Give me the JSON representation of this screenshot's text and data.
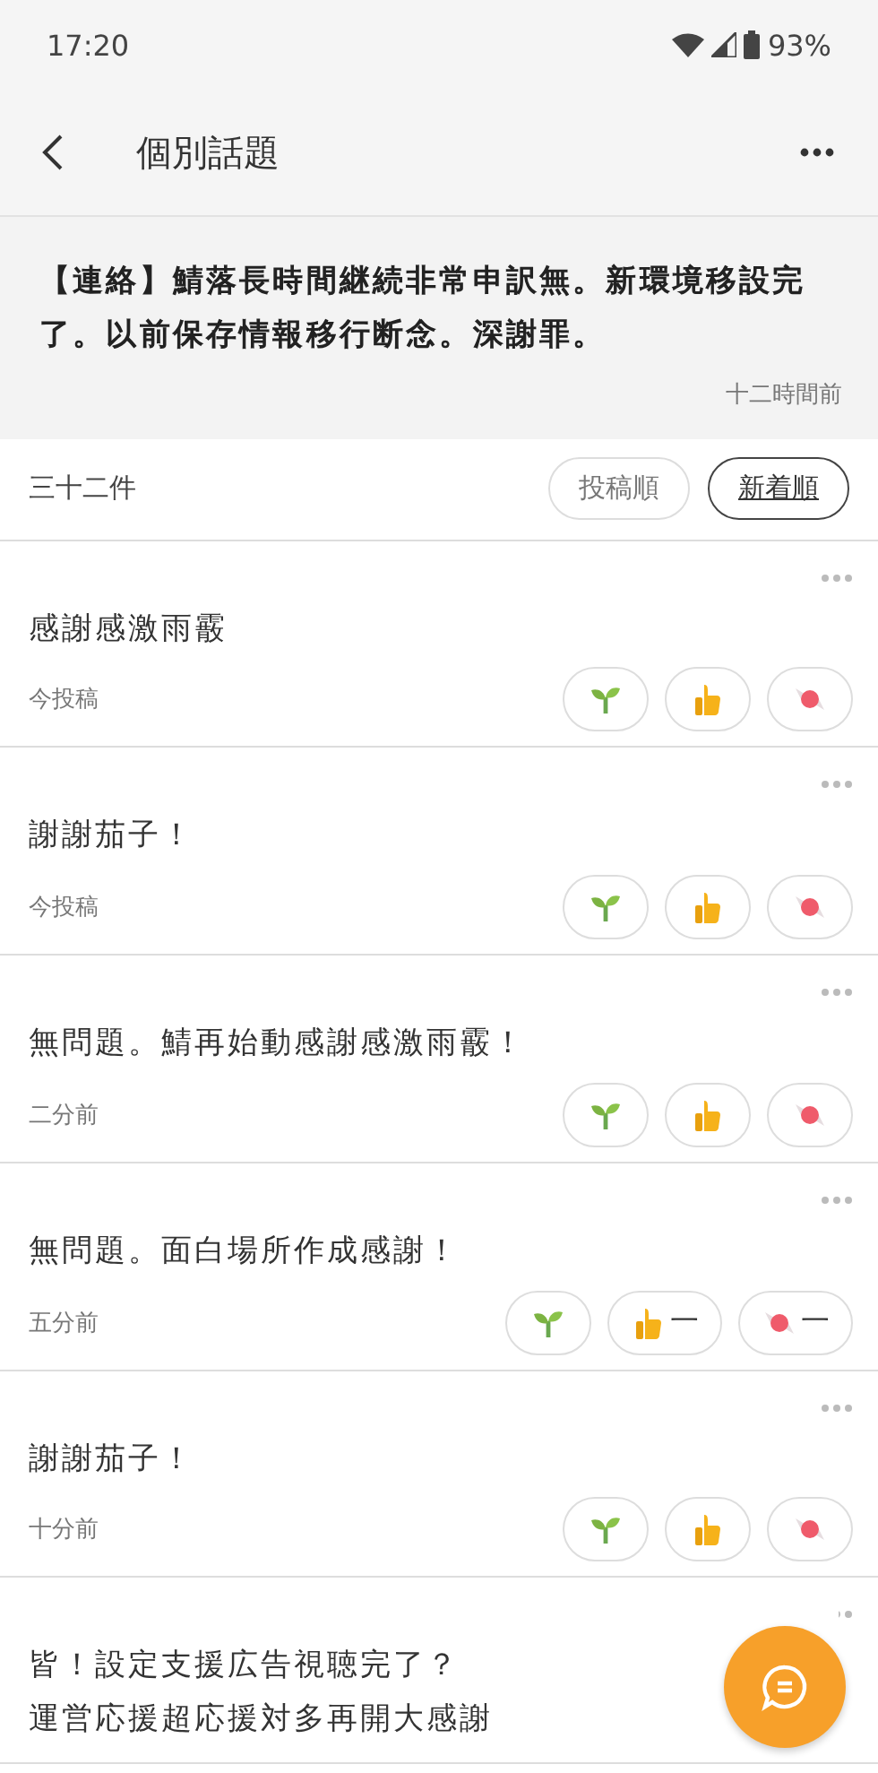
{
  "status_bar": {
    "time": "17:20",
    "battery": "93%"
  },
  "header": {
    "title": "個別話題"
  },
  "announcement": {
    "text": "【連絡】鯖落長時間継続非常申訳無。新環境移設完了。以前保存情報移行断念。深謝罪。",
    "time": "十二時間前"
  },
  "list_header": {
    "count": "三十二件",
    "sort_options": [
      {
        "label": "投稿順",
        "selected": false
      },
      {
        "label": "新着順",
        "selected": true
      }
    ]
  },
  "posts": [
    {
      "text": "感謝感激雨霰",
      "time": "今投稿",
      "reactions": [
        {
          "kind": "sprout"
        },
        {
          "kind": "thumb"
        },
        {
          "kind": "candy"
        }
      ]
    },
    {
      "text": "謝謝茄子！",
      "time": "今投稿",
      "reactions": [
        {
          "kind": "sprout"
        },
        {
          "kind": "thumb"
        },
        {
          "kind": "candy"
        }
      ]
    },
    {
      "text": "無問題。鯖再始動感謝感激雨霰！",
      "time": "二分前",
      "reactions": [
        {
          "kind": "sprout"
        },
        {
          "kind": "thumb"
        },
        {
          "kind": "candy"
        }
      ]
    },
    {
      "text": "無問題。面白場所作成感謝！",
      "time": "五分前",
      "reactions": [
        {
          "kind": "sprout"
        },
        {
          "kind": "thumb",
          "count": "一"
        },
        {
          "kind": "candy",
          "count": "一"
        }
      ]
    },
    {
      "text": "謝謝茄子！",
      "time": "十分前",
      "reactions": [
        {
          "kind": "sprout"
        },
        {
          "kind": "thumb"
        },
        {
          "kind": "candy"
        }
      ]
    },
    {
      "text": "皆！設定支援広告視聴完了？",
      "text_line_2": "運営応援超応援対多再開大感謝"
    }
  ]
}
